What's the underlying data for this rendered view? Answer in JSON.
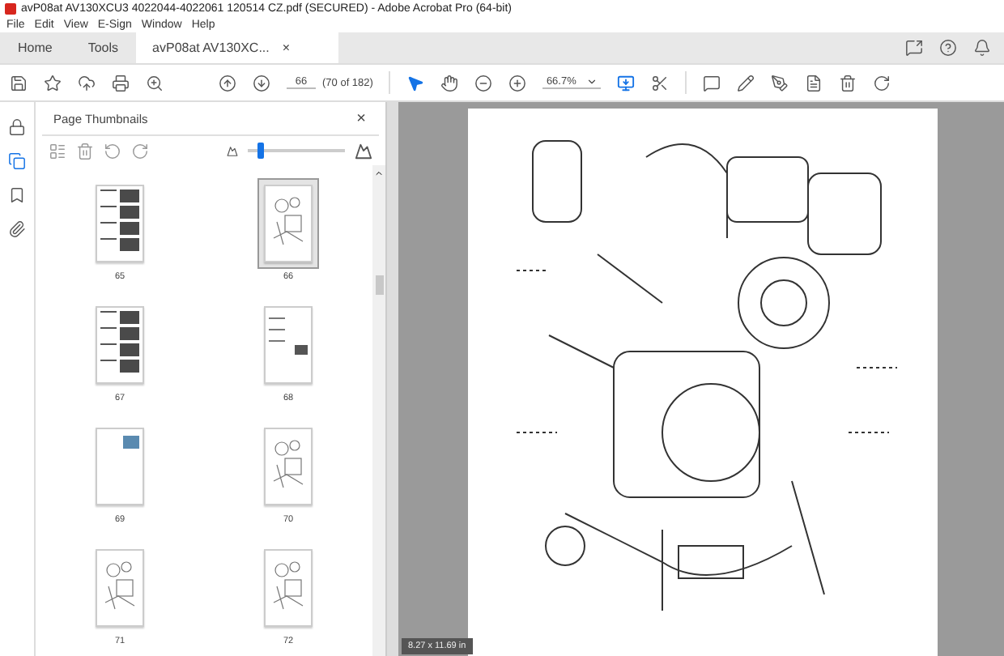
{
  "window": {
    "title": "avP08at AV130XCU3 4022044-4022061 120514 CZ.pdf (SECURED) - Adobe Acrobat Pro (64-bit)"
  },
  "menu": [
    "File",
    "Edit",
    "View",
    "E-Sign",
    "Window",
    "Help"
  ],
  "tabs": [
    {
      "label": "Home",
      "selected": false
    },
    {
      "label": "Tools",
      "selected": false
    },
    {
      "label": "avP08at AV130XC...",
      "selected": true,
      "close": "×"
    }
  ],
  "toolbar": {
    "page_number": "66",
    "page_count": "(70 of 182)",
    "zoom": "66.7%"
  },
  "rail": [
    {
      "kind": "lock",
      "selected": false
    },
    {
      "kind": "pages",
      "selected": true
    },
    {
      "kind": "bookmark",
      "selected": false
    },
    {
      "kind": "clip",
      "selected": false
    }
  ],
  "panel": {
    "title": "Page Thumbnails",
    "close": "×",
    "size_slider": {
      "level": 0.1
    }
  },
  "thumbnails": [
    {
      "label": "65",
      "kind": "photos",
      "selected": false
    },
    {
      "label": "66",
      "kind": "drawing",
      "selected": true
    },
    {
      "label": "67",
      "kind": "photos",
      "selected": false
    },
    {
      "label": "68",
      "kind": "text",
      "selected": false
    },
    {
      "label": "69",
      "kind": "photo-small",
      "selected": false
    },
    {
      "label": "70",
      "kind": "drawing",
      "selected": false
    },
    {
      "label": "71",
      "kind": "drawing",
      "selected": false
    },
    {
      "label": "72",
      "kind": "drawing",
      "selected": false
    }
  ],
  "page_size": "8.27 x 11.69 in"
}
